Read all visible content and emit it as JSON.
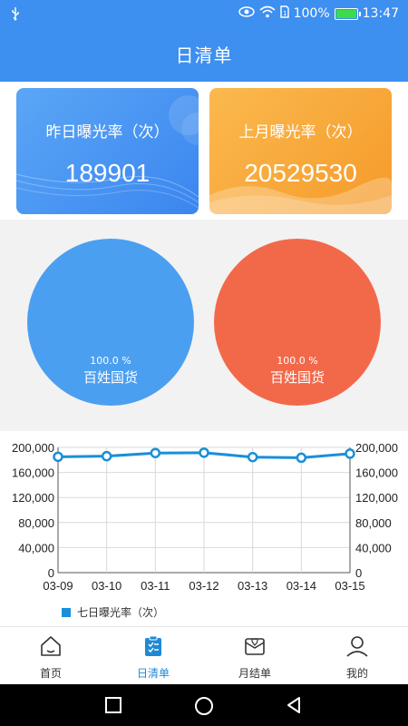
{
  "status_bar": {
    "battery_text": "100%",
    "time": "13:47",
    "usb_icon": "usb-icon",
    "eye_icon": "eye-icon",
    "wifi_icon": "wifi-icon",
    "sim_icon": "sim-icon",
    "battery_icon": "battery-icon"
  },
  "header": {
    "title": "日清单"
  },
  "cards": [
    {
      "label": "昨日曝光率（次）",
      "value": "189901",
      "color": "#3b86ef"
    },
    {
      "label": "上月曝光率（次）",
      "value": "20529530",
      "color": "#f59a2a"
    }
  ],
  "pies": [
    {
      "percent": "100.0 %",
      "name": "百姓国货",
      "color": "#4b9ff0"
    },
    {
      "percent": "100.0 %",
      "name": "百姓国货",
      "color": "#f2694a"
    }
  ],
  "chart_data": {
    "type": "line",
    "x": [
      "03-09",
      "03-10",
      "03-11",
      "03-12",
      "03-13",
      "03-14",
      "03-15"
    ],
    "series": [
      {
        "name": "七日曝光率（次）",
        "values": [
          185000,
          186000,
          191000,
          191500,
          184500,
          183500,
          190000
        ],
        "color": "#1a8fd8"
      }
    ],
    "ylim": [
      0,
      200000
    ],
    "yticks": [
      "0",
      "40,000",
      "80,000",
      "120,000",
      "160,000",
      "200,000"
    ],
    "ytick_values": [
      0,
      40000,
      80000,
      120000,
      160000,
      200000
    ],
    "grid": true,
    "dual_y_axis": true,
    "legend": "bottom-left"
  },
  "tabs": [
    {
      "label": "首页",
      "icon": "home-icon",
      "active": false
    },
    {
      "label": "日清单",
      "icon": "clipboard-icon",
      "active": true
    },
    {
      "label": "月结单",
      "icon": "mail-heart-icon",
      "active": false
    },
    {
      "label": "我的",
      "icon": "person-icon",
      "active": false
    }
  ],
  "navbar": {
    "recents_icon": "recents-square-icon",
    "home_icon": "home-circle-icon",
    "back_icon": "back-triangle-icon"
  },
  "colors": {
    "primary": "#3d8ff0",
    "active_tab": "#1d8ad6"
  }
}
